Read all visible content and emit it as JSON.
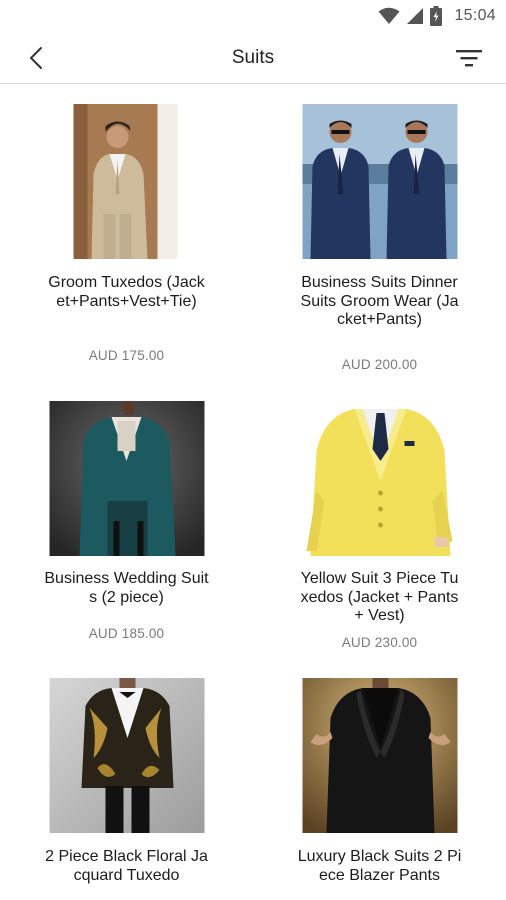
{
  "status": {
    "time": "15:04"
  },
  "header": {
    "title": "Suits"
  },
  "products": [
    {
      "name": "Groom Tuxedos (Jacket+Pants+Vest+Tie)",
      "price": "AUD 175.00"
    },
    {
      "name": "Business Suits Dinner Suits Groom Wear (Jacket+Pants)",
      "price": "AUD 200.00"
    },
    {
      "name": "Business Wedding Suits (2 piece)",
      "price": "AUD 185.00"
    },
    {
      "name": "Yellow Suit 3 Piece Tuxedos  (Jacket + Pants + Vest)",
      "price": "AUD 230.00"
    },
    {
      "name": "2 Piece Black Floral Jacquard Tuxedo",
      "price": ""
    },
    {
      "name": "Luxury Black Suits 2 Piece Blazer Pants",
      "price": ""
    }
  ]
}
